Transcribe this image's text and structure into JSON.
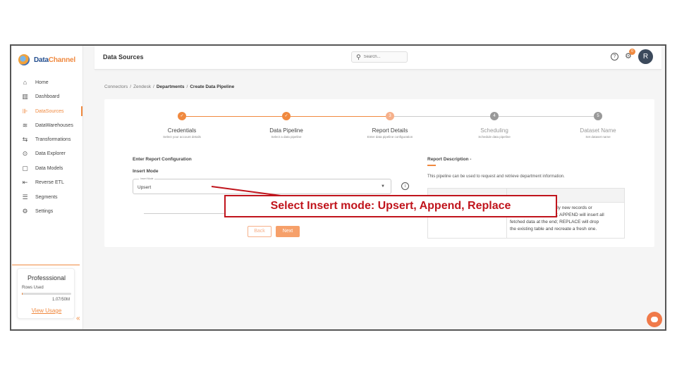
{
  "brand": {
    "name_a": "Data",
    "name_b": "Channel"
  },
  "sidebar": {
    "items": [
      {
        "label": "Home",
        "icon": "home-icon",
        "glyph": "⌂"
      },
      {
        "label": "Dashboard",
        "icon": "dashboard-icon",
        "glyph": "▥"
      },
      {
        "label": "DataSources",
        "icon": "datasources-icon",
        "glyph": "⊪",
        "active": true
      },
      {
        "label": "DataWarehouses",
        "icon": "database-icon",
        "glyph": "≋"
      },
      {
        "label": "Transformations",
        "icon": "transform-icon",
        "glyph": "⇆"
      },
      {
        "label": "Data Explorer",
        "icon": "explorer-icon",
        "glyph": "⊙"
      },
      {
        "label": "Data Models",
        "icon": "models-icon",
        "glyph": "▢"
      },
      {
        "label": "Reverse ETL",
        "icon": "reverse-etl-icon",
        "glyph": "⇤"
      },
      {
        "label": "Segments",
        "icon": "segments-icon",
        "glyph": "☰"
      },
      {
        "label": "Settings",
        "icon": "gear-icon",
        "glyph": "⚙"
      }
    ],
    "plan": {
      "title": "Professsional",
      "rows_label": "Rows Used",
      "usage": "1.07/50M",
      "usage_fraction": 0.02,
      "view_link": "View Usage"
    },
    "collapse_glyph": "«"
  },
  "header": {
    "title": "Data Sources",
    "search_placeholder": "Search...",
    "notification_count": "0",
    "avatar_initial": "R"
  },
  "breadcrumb": {
    "items": [
      "Connectors",
      "Zendesk",
      "Departments",
      "Create Data Pipeline"
    ]
  },
  "steps": [
    {
      "title": "Credentials",
      "subtitle": "Select your account details",
      "state": "done",
      "number": "1"
    },
    {
      "title": "Data Pipeline",
      "subtitle": "Select a data pipeline",
      "state": "done",
      "number": "2"
    },
    {
      "title": "Report Details",
      "subtitle": "Enter data pipeline configuration",
      "state": "current",
      "number": "3"
    },
    {
      "title": "Scheduling",
      "subtitle": "Schedule data pipeline",
      "state": "todo",
      "number": "4"
    },
    {
      "title": "Dataset Name",
      "subtitle": "Set dataset name",
      "state": "todo",
      "number": "5"
    }
  ],
  "form": {
    "section_title": "Enter Report Configuration",
    "mode_label": "Insert Mode",
    "mode_floating_label": "Insert Mode",
    "mode_value": "Upsert",
    "back_label": "Back",
    "next_label": "Next"
  },
  "report": {
    "title": "Report Description -",
    "text": "This pipeline can be used to request and retrieve department information.",
    "table_visible_text": [
      "only new records or",
      "es; APPEND will insert all",
      "fetched data at the end; REPLACE will drop",
      "the existing table and recreate a fresh one."
    ]
  },
  "annotation": {
    "text": "Select Insert mode: Upsert, Append, Replace",
    "color": "#c0141c"
  },
  "colors": {
    "accent": "#f0893f",
    "accent_light": "#f6b08a"
  }
}
